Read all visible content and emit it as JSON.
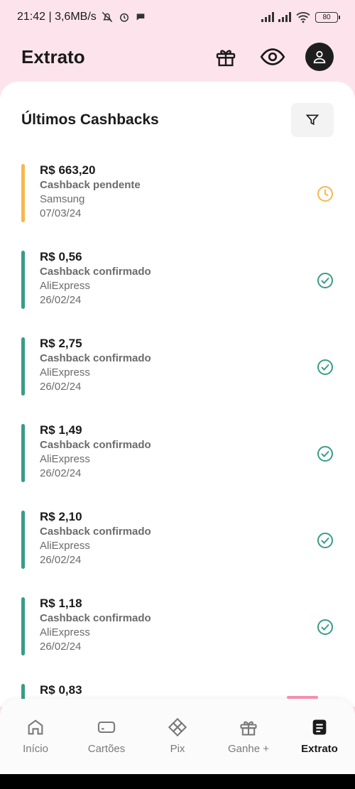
{
  "status_bar": {
    "time_speed": "21:42 | 3,6MB/s",
    "battery": "80"
  },
  "header": {
    "title": "Extrato"
  },
  "section": {
    "title": "Últimos Cashbacks"
  },
  "cashbacks": [
    {
      "amount": "R$ 663,20",
      "status": "Cashback pendente",
      "store": "Samsung",
      "date": "07/03/24",
      "state": "pending"
    },
    {
      "amount": "R$ 0,56",
      "status": "Cashback confirmado",
      "store": "AliExpress",
      "date": "26/02/24",
      "state": "confirmed"
    },
    {
      "amount": "R$ 2,75",
      "status": "Cashback confirmado",
      "store": "AliExpress",
      "date": "26/02/24",
      "state": "confirmed"
    },
    {
      "amount": "R$ 1,49",
      "status": "Cashback confirmado",
      "store": "AliExpress",
      "date": "26/02/24",
      "state": "confirmed"
    },
    {
      "amount": "R$ 2,10",
      "status": "Cashback confirmado",
      "store": "AliExpress",
      "date": "26/02/24",
      "state": "confirmed"
    },
    {
      "amount": "R$ 1,18",
      "status": "Cashback confirmado",
      "store": "AliExpress",
      "date": "26/02/24",
      "state": "confirmed"
    },
    {
      "amount": "R$ 0,83",
      "status": "",
      "store": "",
      "date": "",
      "state": "confirmed"
    }
  ],
  "nav": {
    "items": [
      {
        "label": "Início",
        "icon": "home-icon"
      },
      {
        "label": "Cartões",
        "icon": "card-icon"
      },
      {
        "label": "Pix",
        "icon": "pix-icon"
      },
      {
        "label": "Ganhe +",
        "icon": "gift-icon"
      },
      {
        "label": "Extrato",
        "icon": "statement-icon",
        "active": true
      }
    ]
  },
  "colors": {
    "pending": "#f5b84e",
    "confirmed": "#3a9c86",
    "header_bg": "#fde4ec",
    "nav_indicator": "#f28fb0"
  }
}
